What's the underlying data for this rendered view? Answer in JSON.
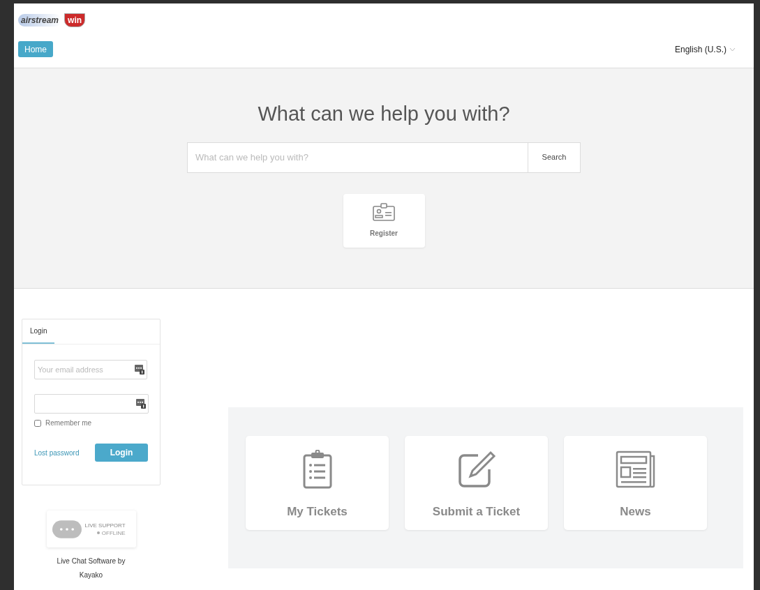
{
  "logo": {
    "left": "airstream",
    "right": "win"
  },
  "nav": [
    {
      "label": "Home",
      "selected": true
    }
  ],
  "language": {
    "label": "English (U.S.)"
  },
  "hero": {
    "title": "What can we help you with?",
    "search": {
      "placeholder": "What can we help you with?",
      "button": "Search"
    },
    "tile": {
      "label": "Register"
    }
  },
  "login": {
    "tabs": [
      {
        "label": "Login",
        "selected": true
      }
    ],
    "email": {
      "placeholder": "Your email address"
    },
    "remember": {
      "label": "Remember me",
      "checked": false
    },
    "lost_password": "Lost password",
    "button": "Login"
  },
  "live_support": {
    "title": "LIVE SUPPORT",
    "status": "OFFLINE",
    "caption": "Live Chat Software by Kayako"
  },
  "tiles": [
    {
      "kind": "tickets",
      "label": "My Tickets"
    },
    {
      "kind": "submit",
      "label": "Submit a Ticket"
    },
    {
      "kind": "news",
      "label": "News"
    }
  ]
}
